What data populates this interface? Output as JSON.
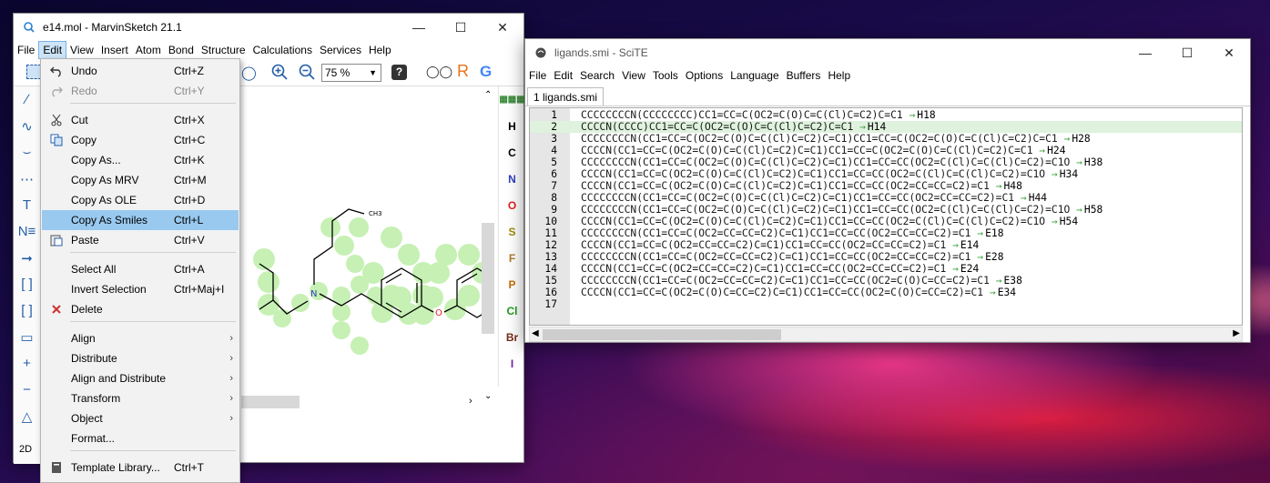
{
  "marvin": {
    "title": "e14.mol - MarvinSketch 21.1",
    "menus": [
      "File",
      "Edit",
      "View",
      "Insert",
      "Atom",
      "Bond",
      "Structure",
      "Calculations",
      "Services",
      "Help"
    ],
    "zoom": "75 %",
    "canvas": {
      "labels": {
        "ch3": "CH3",
        "n": "N",
        "o": "O"
      }
    },
    "left_tools": [
      "line-tool",
      "chain-tool",
      "arc-tool",
      "dash-tool",
      "text-tool",
      "atom-list-tool",
      "arrow-tool",
      "bracket-tool",
      "square-bracket-tool",
      "rect-tool",
      "plus-tool",
      "minus-tool",
      "triangle-tool"
    ],
    "left_footer": "2D",
    "right_elements": [
      {
        "symbol": "H",
        "color": "#000000"
      },
      {
        "symbol": "C",
        "color": "#000000"
      },
      {
        "symbol": "N",
        "color": "#2f3fbf"
      },
      {
        "symbol": "O",
        "color": "#e02020"
      },
      {
        "symbol": "S",
        "color": "#9c8a00"
      },
      {
        "symbol": "F",
        "color": "#b07a2a"
      },
      {
        "symbol": "P",
        "color": "#c96f00"
      },
      {
        "symbol": "Cl",
        "color": "#1f9a1f"
      },
      {
        "symbol": "Br",
        "color": "#7a2a1a"
      },
      {
        "symbol": "I",
        "color": "#7a1aa8"
      }
    ],
    "toolbar_letters": {
      "r": "R"
    }
  },
  "edit_menu": {
    "items": [
      {
        "label": "Undo",
        "shortcut": "Ctrl+Z",
        "icon": "undo-icon",
        "disabled": false
      },
      {
        "label": "Redo",
        "shortcut": "Ctrl+Y",
        "icon": "redo-icon",
        "disabled": true
      },
      {
        "label": "Cut",
        "shortcut": "Ctrl+X",
        "icon": "cut-icon",
        "disabled": false
      },
      {
        "label": "Copy",
        "shortcut": "Ctrl+C",
        "icon": "copy-icon",
        "disabled": false
      },
      {
        "label": "Copy As...",
        "shortcut": "Ctrl+K",
        "icon": "",
        "disabled": false
      },
      {
        "label": "Copy As MRV",
        "shortcut": "Ctrl+M",
        "icon": "",
        "disabled": false
      },
      {
        "label": "Copy As OLE",
        "shortcut": "Ctrl+D",
        "icon": "",
        "disabled": false
      },
      {
        "label": "Copy As Smiles",
        "shortcut": "Ctrl+L",
        "icon": "",
        "disabled": false,
        "highlighted": true
      },
      {
        "label": "Paste",
        "shortcut": "Ctrl+V",
        "icon": "paste-icon",
        "disabled": false
      },
      {
        "label": "Select All",
        "shortcut": "Ctrl+A",
        "icon": "",
        "disabled": false
      },
      {
        "label": "Invert Selection",
        "shortcut": "Ctrl+Maj+I",
        "icon": "",
        "disabled": false
      },
      {
        "label": "Delete",
        "shortcut": "",
        "icon": "delete-icon",
        "disabled": false
      },
      {
        "label": "Align",
        "shortcut": "",
        "icon": "",
        "submenu": true
      },
      {
        "label": "Distribute",
        "shortcut": "",
        "icon": "",
        "submenu": true
      },
      {
        "label": "Align and Distribute",
        "shortcut": "",
        "icon": "",
        "submenu": true
      },
      {
        "label": "Transform",
        "shortcut": "",
        "icon": "",
        "submenu": true
      },
      {
        "label": "Object",
        "shortcut": "",
        "icon": "",
        "submenu": true
      },
      {
        "label": "Format...",
        "shortcut": "",
        "icon": ""
      },
      {
        "label": "Template Library...",
        "shortcut": "Ctrl+T",
        "icon": "book-icon"
      }
    ]
  },
  "scite": {
    "title": "ligands.smi - SciTE",
    "menus": [
      "File",
      "Edit",
      "Search",
      "View",
      "Tools",
      "Options",
      "Language",
      "Buffers",
      "Help"
    ],
    "tab": "1 ligands.smi",
    "lines": [
      {
        "n": "1",
        "smiles": "CCCCCCCCN(CCCCCCCC)CC1=CC=C(OC2=C(O)C=C(Cl)C=C2)C=C1",
        "id": "H18"
      },
      {
        "n": "2",
        "smiles": "CCCCN(CCCC)CC1=CC=C(OC2=C(O)C=C(Cl)C=C2)C=C1",
        "id": "H14"
      },
      {
        "n": "3",
        "smiles": "CCCCCCCCN(CC1=CC=C(OC2=C(O)C=C(Cl)C=C2)C=C1)CC1=CC=C(OC2=C(O)C=C(Cl)C=C2)C=C1",
        "id": "H28"
      },
      {
        "n": "4",
        "smiles": "CCCCN(CC1=CC=C(OC2=C(O)C=C(Cl)C=C2)C=C1)CC1=CC=C(OC2=C(O)C=C(Cl)C=C2)C=C1",
        "id": "H24"
      },
      {
        "n": "5",
        "smiles": "CCCCCCCCN(CC1=CC=C(OC2=C(O)C=C(Cl)C=C2)C=C1)CC1=CC=CC(OC2=C(Cl)C=C(Cl)C=C2)=C1O",
        "id": "H38"
      },
      {
        "n": "6",
        "smiles": "CCCCN(CC1=CC=C(OC2=C(O)C=C(Cl)C=C2)C=C1)CC1=CC=CC(OC2=C(Cl)C=C(Cl)C=C2)=C1O",
        "id": "H34"
      },
      {
        "n": "7",
        "smiles": "CCCCN(CC1=CC=C(OC2=C(O)C=C(Cl)C=C2)C=C1)CC1=CC=CC(OC2=CC=CC=C2)=C1",
        "id": "H48"
      },
      {
        "n": "8",
        "smiles": "CCCCCCCCN(CC1=CC=C(OC2=C(O)C=C(Cl)C=C2)C=C1)CC1=CC=CC(OC2=CC=CC=C2)=C1",
        "id": "H44"
      },
      {
        "n": "9",
        "smiles": "CCCCCCCCN(CC1=CC=C(OC2=C(O)C=C(Cl)C=C2)C=C1)CC1=CC=CC(OC2=C(Cl)C=C(Cl)C=C2)=C1O",
        "id": "H58"
      },
      {
        "n": "10",
        "smiles": "CCCCN(CC1=CC=C(OC2=C(O)C=C(Cl)C=C2)C=C1)CC1=CC=CC(OC2=C(Cl)C=C(Cl)C=C2)=C1O",
        "id": "H54"
      },
      {
        "n": "11",
        "smiles": "CCCCCCCCN(CC1=CC=C(OC2=CC=CC=C2)C=C1)CC1=CC=CC(OC2=CC=CC=C2)=C1",
        "id": "E18"
      },
      {
        "n": "12",
        "smiles": "CCCCN(CC1=CC=C(OC2=CC=CC=C2)C=C1)CC1=CC=CC(OC2=CC=CC=C2)=C1",
        "id": "E14"
      },
      {
        "n": "13",
        "smiles": "CCCCCCCCN(CC1=CC=C(OC2=CC=CC=C2)C=C1)CC1=CC=CC(OC2=CC=CC=C2)=C1",
        "id": "E28"
      },
      {
        "n": "14",
        "smiles": "CCCCN(CC1=CC=C(OC2=CC=CC=C2)C=C1)CC1=CC=CC(OC2=CC=CC=C2)=C1",
        "id": "E24"
      },
      {
        "n": "15",
        "smiles": "CCCCCCCCN(CC1=CC=C(OC2=CC=CC=C2)C=C1)CC1=CC=CC(OC2=C(O)C=CC=C2)=C1",
        "id": "E38"
      },
      {
        "n": "16",
        "smiles": "CCCCN(CC1=CC=C(OC2=C(O)C=CC=C2)C=C1)CC1=CC=CC(OC2=C(O)C=CC=C2)=C1",
        "id": "E34"
      },
      {
        "n": "17",
        "smiles": "",
        "id": ""
      }
    ],
    "highlight_line": 2,
    "highlight_color": "#dff2dd",
    "arrow_color": "#3aa33a"
  }
}
